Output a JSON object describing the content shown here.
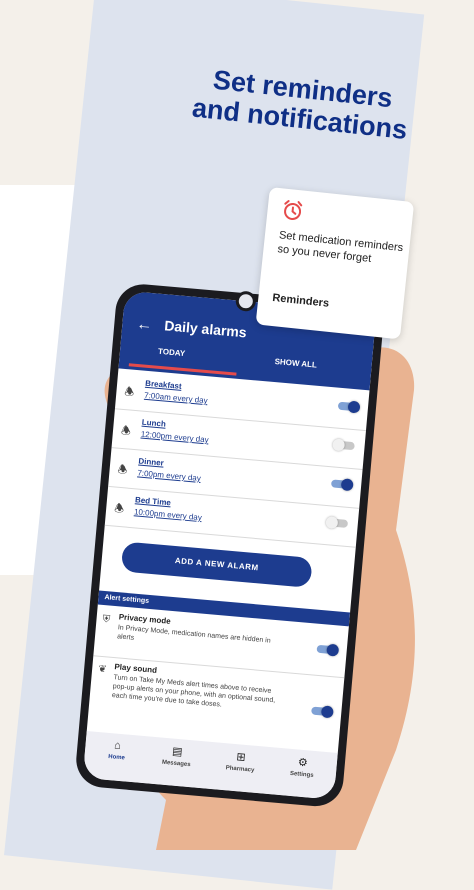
{
  "headline": {
    "line1": "Set reminders",
    "line2": "and notifications"
  },
  "app": {
    "title": "Daily alarms",
    "tabs": [
      "TODAY",
      "SHOW ALL"
    ],
    "alarms": [
      {
        "name": "Breakfast",
        "time": "7:00am every day",
        "enabled": true
      },
      {
        "name": "Lunch",
        "time": "12:00pm every day",
        "enabled": false
      },
      {
        "name": "Dinner",
        "time": "7:00pm every day",
        "enabled": true
      },
      {
        "name": "Bed Time",
        "time": "10:00pm every day",
        "enabled": false
      }
    ],
    "add_button": "ADD A NEW ALARM",
    "alert_settings_title": "Alert settings",
    "settings": [
      {
        "title": "Privacy mode",
        "desc": "In Privacy Mode, medication names are hidden in alerts",
        "enabled": true
      },
      {
        "title": "Play sound",
        "desc": "Turn on Take My Meds alert times above to receive pop-up alerts on your phone, with an optional sound, each time you're due to take doses.",
        "enabled": true
      }
    ],
    "nav": [
      "Home",
      "Messages",
      "Pharmacy",
      "Settings"
    ]
  },
  "tooltip": {
    "text": "Set medication reminders so you never forget",
    "link": "Reminders"
  },
  "colors": {
    "primary": "#1d3c8f",
    "accent": "#e54b4b",
    "panel": "#dde3ee",
    "background": "#f4f0ea"
  }
}
